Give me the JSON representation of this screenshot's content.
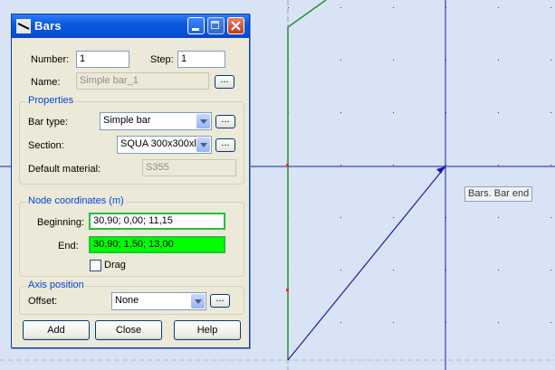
{
  "dialog": {
    "title": "Bars",
    "number_label": "Number:",
    "number_value": "1",
    "step_label": "Step:",
    "step_value": "1",
    "name_label": "Name:",
    "name_value": "Simple bar_1",
    "browse_label": "...",
    "properties": {
      "title": "Properties",
      "bar_type_label": "Bar type:",
      "bar_type_value": "Simple bar",
      "section_label": "Section:",
      "section_value": "SQUA 300x300xl",
      "material_label": "Default material:",
      "material_value": "S355"
    },
    "node_coordinates": {
      "title": "Node coordinates (m)",
      "beginning_label": "Beginning:",
      "beginning_value": "30,90; 0,00; 11,15",
      "end_label": "End:",
      "end_value": "30,90; 1,50; 13,00",
      "drag_label": "Drag",
      "drag_checked": false
    },
    "axis_position": {
      "title": "Axis position",
      "offset_label": "Offset:",
      "offset_value": "None"
    },
    "buttons": {
      "add": "Add",
      "close": "Close",
      "help": "Help"
    }
  },
  "canvas": {
    "tooltip": "Bars. Bar end",
    "background_color": "#d8e4f6",
    "axis_color": "#1a1aa8"
  }
}
